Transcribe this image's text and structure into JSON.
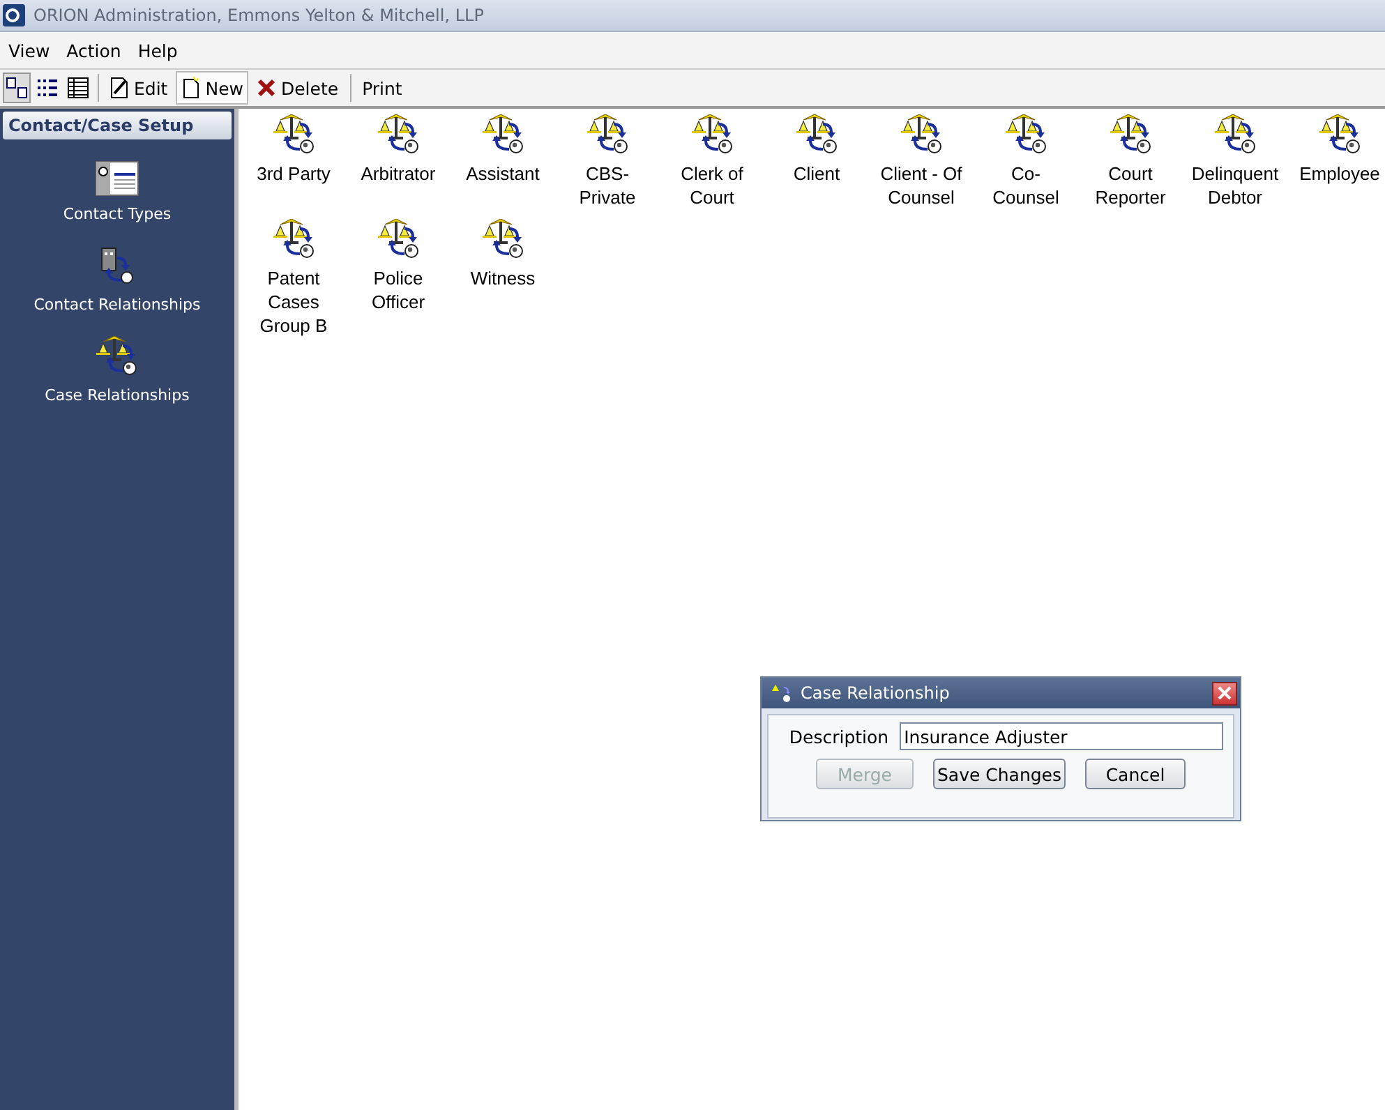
{
  "window": {
    "title": "ORION Administration, Emmons Yelton & Mitchell, LLP"
  },
  "menu": [
    "View",
    "Action",
    "Help"
  ],
  "view_buttons": [
    {
      "kind": "large",
      "selected": true
    },
    {
      "kind": "list",
      "selected": false
    },
    {
      "kind": "details",
      "selected": false
    }
  ],
  "toolbar": [
    {
      "kind": "edit",
      "label": "Edit",
      "selected": false
    },
    {
      "kind": "new",
      "label": "New",
      "selected": true
    },
    {
      "kind": "delete",
      "label": "Delete",
      "selected": false
    },
    {
      "kind": "print",
      "label": "Print",
      "selected": false
    }
  ],
  "sidebar": {
    "header": "Contact/Case Setup",
    "items": [
      {
        "kind": "card",
        "label": "Contact Types"
      },
      {
        "kind": "building",
        "label": "Contact Relationships"
      },
      {
        "kind": "scales",
        "label": "Case Relationships"
      }
    ]
  },
  "items": [
    "3rd Party",
    "Arbitrator",
    "Assistant",
    "CBS-Private",
    "Clerk of Court",
    "Client",
    "Client - Of Counsel",
    "Co-Counsel",
    "Court Reporter",
    "Delinquent Debtor",
    "Employee",
    "Patent Cases Group B",
    "Police Officer",
    "Witness"
  ],
  "dialog": {
    "title": "Case Relationship",
    "field_label": "Description",
    "value": "Insurance Adjuster",
    "buttons": [
      {
        "label": "Merge",
        "disabled": true
      },
      {
        "label": "Save Changes",
        "disabled": false
      },
      {
        "label": "Cancel",
        "disabled": false
      }
    ]
  }
}
